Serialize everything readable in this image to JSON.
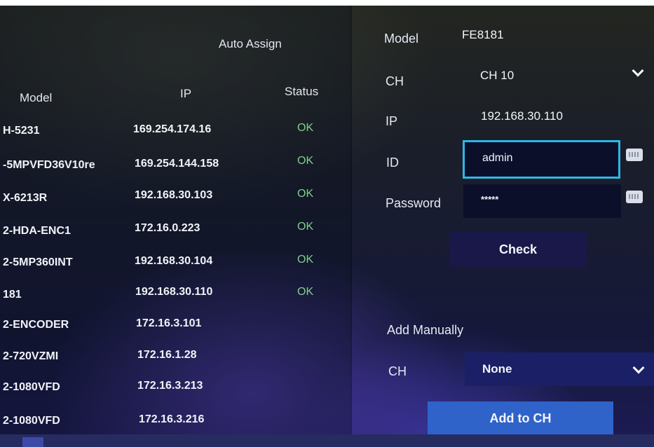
{
  "device_list": {
    "auto_assign_label": "Auto Assign",
    "columns": {
      "model": "Model",
      "ip": "IP",
      "status": "Status"
    },
    "rows": [
      {
        "model": "H-5231",
        "ip": "169.254.174.16",
        "status": "OK"
      },
      {
        "model": "-5MPVFD36V10re",
        "ip": "169.254.144.158",
        "status": "OK"
      },
      {
        "model": "X-6213R",
        "ip": "192.168.30.103",
        "status": "OK"
      },
      {
        "model": "2-HDA-ENC1",
        "ip": "172.16.0.223",
        "status": "OK"
      },
      {
        "model": "2-5MP360INT",
        "ip": "192.168.30.104",
        "status": "OK"
      },
      {
        "model": "181",
        "ip": "192.168.30.110",
        "status": "OK"
      },
      {
        "model": "2-ENCODER",
        "ip": "172.16.3.101",
        "status": ""
      },
      {
        "model": "2-720VZMI",
        "ip": "172.16.1.28",
        "status": ""
      },
      {
        "model": "2-1080VFD",
        "ip": "172.16.3.213",
        "status": ""
      },
      {
        "model": "2-1080VFD",
        "ip": "172.16.3.216",
        "status": ""
      }
    ]
  },
  "detail": {
    "model_label": "Model",
    "model_value": "FE8181",
    "ch_label": "CH",
    "ch_value": "CH 10",
    "ip_label": "IP",
    "ip_value": "192.168.30.110",
    "id_label": "ID",
    "id_value": "admin",
    "password_label": "Password",
    "password_value": "*****",
    "check_button": "Check"
  },
  "manual": {
    "title": "Add Manually",
    "ch_label": "CH",
    "ch_value": "None",
    "add_button": "Add to CH"
  },
  "colors": {
    "status_ok": "#7fd08a",
    "focus_border": "#2fb6e6",
    "button_bg": "#1a1848",
    "add_button_bg": "#2f63c9"
  },
  "icons": {
    "keyboard": "keyboard-icon",
    "dropdown": "chevron-down-icon"
  }
}
